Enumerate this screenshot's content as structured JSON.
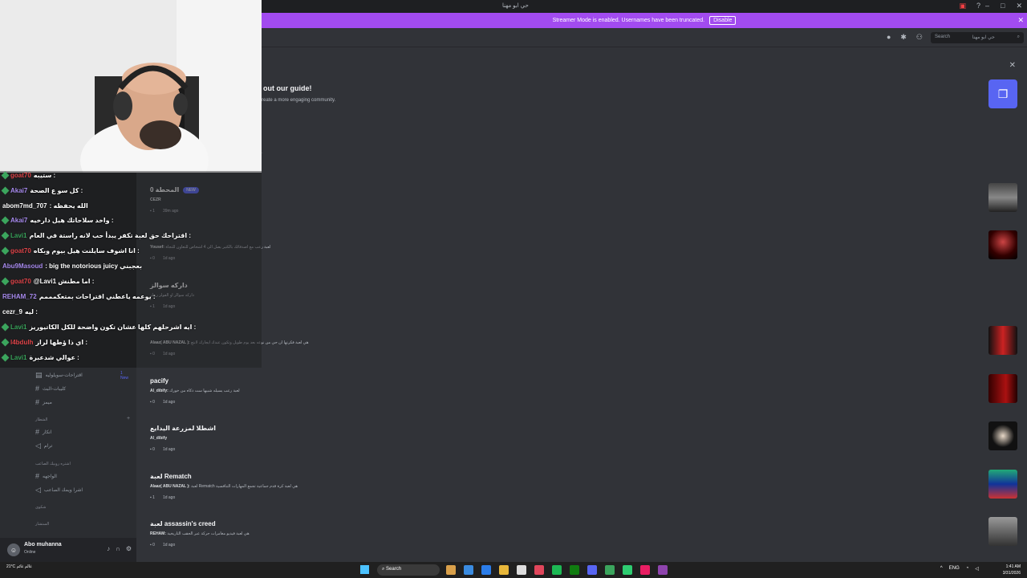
{
  "window": {
    "title": "حي ابو مهنا"
  },
  "banner": {
    "text": "Streamer Mode is enabled. Usernames have been truncated.",
    "button": "Disable"
  },
  "header": {
    "search_placeholder": "Search",
    "search_scope": "حي ابو مهنا"
  },
  "guide": {
    "title": "out our guide!",
    "subtitle": "reate a more engaging community."
  },
  "posts": [
    {
      "title": "المحطة 0",
      "tag": "NEW",
      "author": "CEZR",
      "message": "",
      "replies": "1",
      "time": "39m ago"
    },
    {
      "title": "",
      "tag": "",
      "author": "Yousef:",
      "message": "لعبة رعب مع اصدقائك بالكثير يصل الى 4 اشخاص للتعاون للنجاة",
      "replies": "0",
      "time": "1d ago"
    },
    {
      "title": "داركه سوالز",
      "tag": "",
      "author": "",
      "message": "داركه سوالز او الفولز ريبلز",
      "replies": "1",
      "time": "1d ago"
    },
    {
      "title": "",
      "tag": "",
      "author": "Alaaz( ABU NAZAL ):",
      "message": "هي لعبة فكرتها ان حي من نوعه بعد يوم طويل وتكون عندك ايجارك لابتع",
      "replies": "0",
      "time": "1d ago"
    },
    {
      "title": "pacify",
      "tag": "",
      "author": "Al_dibify:",
      "message": "لعبة رعب يسيله شبيها ست ذكاه من خورك",
      "replies": "0",
      "time": "1d ago"
    },
    {
      "title": "اشطلا لمزرعة اليدايع",
      "tag": "",
      "author": "Al_dibify",
      "message": "",
      "replies": "0",
      "time": "1d ago"
    },
    {
      "title": "لعبة Rematch",
      "tag": "",
      "author": "Alaaz( ABU NAZAL ):",
      "message": "لعبة Rematch هي لعبة كرة قدم جماعية تجمع المهارات التنافسية",
      "replies": "1",
      "time": "1d ago"
    },
    {
      "title": "لعبة assassin's creed",
      "tag": "",
      "author": "REHAM:",
      "message": "هي لعبة فيديو مغامرات حركة عبر الحقب التاريخية",
      "replies": "0",
      "time": "1d ago"
    }
  ],
  "chat": [
    {
      "user": "goat70",
      "color": "#e0464b",
      "msg": "ستيبه :"
    },
    {
      "user": "Akai7",
      "color": "#a98cf0",
      "msg": "كل سو ع الصحة :"
    },
    {
      "user": "abom7md_707",
      "color": "#ffffff",
      "msg": ": الله يحفظه"
    },
    {
      "user": "Akai7",
      "color": "#a98cf0",
      "msg": "واخد سلاحاتك هيل دارخيه :"
    },
    {
      "user": "Lavi1",
      "color": "#3ba55d",
      "msg": "اقتراحك حق لعبة تكفر يبدأ حب لانه راستة في العام :"
    },
    {
      "user": "goat70",
      "color": "#e0464b",
      "msg": "انا اشوف سايلنت هيل بيوم وبكاه :"
    },
    {
      "user": "Abu9Masoud",
      "color": "#a98cf0",
      "msg": ": big the notorious juicy بعجبني"
    },
    {
      "user": "goat70",
      "color": "#e0464b",
      "msg": "@Lavi1 اما مطنش :"
    },
    {
      "user": "REHAM_72",
      "color": "#a98cf0",
      "msg": "يوعمه ياعطني اقتراحات بمتعكمممم :"
    },
    {
      "user": "cezr_9",
      "color": "#ffffff",
      "msg": "ليه :"
    },
    {
      "user": "Lavi1",
      "color": "#3ba55d",
      "msg": "ايه اشرحلهم كلها عشان تكون واضحة للكل الكاتيوريز :"
    },
    {
      "user": "l4bdulh",
      "color": "#e0464b",
      "msg": "اي ذا ؤطها لراز :"
    },
    {
      "user": "Lavi1",
      "color": "#3ba55d",
      "msg": "عوالي شدعبرة :"
    }
  ],
  "sidebar": {
    "channels": [
      {
        "name": "اقتراحات-سويلوليه",
        "badge": "1 New",
        "type": "forum"
      },
      {
        "name": "كليبات-البث",
        "badge": "",
        "type": "text"
      },
      {
        "name": "ميمز",
        "badge": "",
        "type": "text"
      },
      {
        "name": "انكار",
        "badge": "",
        "type": "text"
      },
      {
        "name": "ترام",
        "badge": "",
        "type": "voice"
      },
      {
        "name": "الواجهه",
        "badge": "",
        "type": "text"
      },
      {
        "name": "اشرا ويمك الصاعب",
        "badge": "",
        "type": "voice"
      }
    ],
    "categories": [
      "الشطار",
      "اشتره روبيك الصاعب",
      "شكوى",
      "الستشار"
    ]
  },
  "user": {
    "name": "Abo muhanna",
    "status": "Online"
  },
  "taskbar": {
    "weather_temp": "21°C",
    "weather_desc": "غالم غائم",
    "search_label": "Search",
    "lang": "ENG",
    "time": "1:41 AM",
    "date": "3/31/2026"
  }
}
